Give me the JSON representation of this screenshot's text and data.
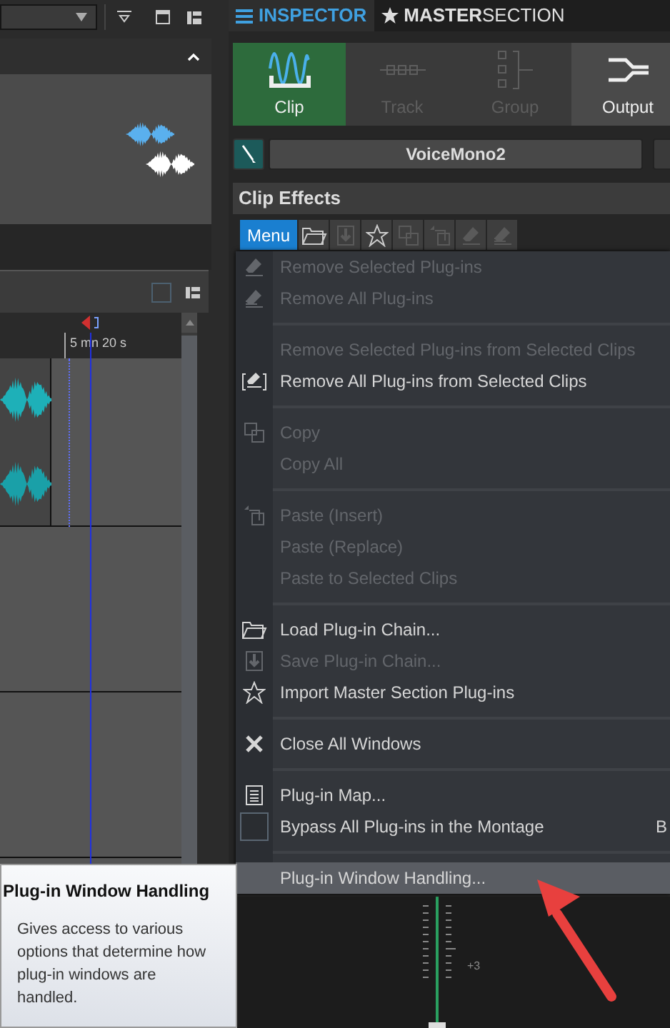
{
  "timeline": {
    "ruler_label": "5 mn 20 s"
  },
  "tabs": [
    {
      "label": "INSPECTOR",
      "selected": true
    },
    {
      "label": "**MASTER**SECTION",
      "selected": false
    }
  ],
  "inspector_buttons": [
    {
      "label": "Clip",
      "selected": true,
      "disabled": false
    },
    {
      "label": "Track",
      "selected": false,
      "disabled": true
    },
    {
      "label": "Group",
      "selected": false,
      "disabled": true
    },
    {
      "label": "Output",
      "selected": false,
      "disabled": false
    }
  ],
  "clip_name": "VoiceMono2",
  "panel_title": "Clip Effects",
  "menu_button": {
    "label": "Menu",
    "selected": true
  },
  "menu": {
    "groups": [
      [
        {
          "kind": "command",
          "label": "Remove Selected Plug-ins",
          "disabled": true,
          "selected": false
        },
        {
          "kind": "command",
          "label": "Remove All Plug-ins",
          "disabled": true,
          "selected": false
        }
      ],
      [
        {
          "kind": "command",
          "label": "Remove Selected Plug-ins from Selected Clips",
          "disabled": true,
          "selected": false
        },
        {
          "kind": "command",
          "label": "Remove All Plug-ins from Selected Clips",
          "disabled": false,
          "selected": false
        }
      ],
      [
        {
          "kind": "command",
          "label": "Copy",
          "disabled": true,
          "selected": false
        },
        {
          "kind": "command",
          "label": "Copy All",
          "disabled": true,
          "selected": false
        }
      ],
      [
        {
          "kind": "command",
          "label": "Paste (Insert)",
          "disabled": true,
          "selected": false
        },
        {
          "kind": "command",
          "label": "Paste (Replace)",
          "disabled": true,
          "selected": false
        },
        {
          "kind": "command",
          "label": "Paste to Selected Clips",
          "disabled": true,
          "selected": false
        }
      ],
      [
        {
          "kind": "command",
          "label": "Load Plug-in Chain...",
          "disabled": false,
          "selected": false
        },
        {
          "kind": "command",
          "label": "Save Plug-in Chain...",
          "disabled": true,
          "selected": false
        },
        {
          "kind": "command",
          "label": "Import Master Section Plug-ins",
          "disabled": false,
          "selected": false
        }
      ],
      [
        {
          "kind": "command",
          "label": "Close All Windows",
          "disabled": false,
          "selected": false
        }
      ],
      [
        {
          "kind": "command",
          "label": "Plug-in Map...",
          "disabled": false,
          "selected": false
        },
        {
          "kind": "checkbox",
          "label": "Bypass All Plug-ins in the Montage",
          "disabled": false,
          "selected": false,
          "checked": false,
          "shortcut": "B"
        }
      ],
      [
        {
          "kind": "command",
          "label": "Plug-in Window Handling...",
          "disabled": false,
          "selected": true
        }
      ]
    ]
  },
  "tooltip": {
    "title": "Plug-in Window Handling",
    "text": "Gives access to various options that determine how plug-in windows are handled."
  },
  "fader": {
    "scale_label": "+3"
  }
}
